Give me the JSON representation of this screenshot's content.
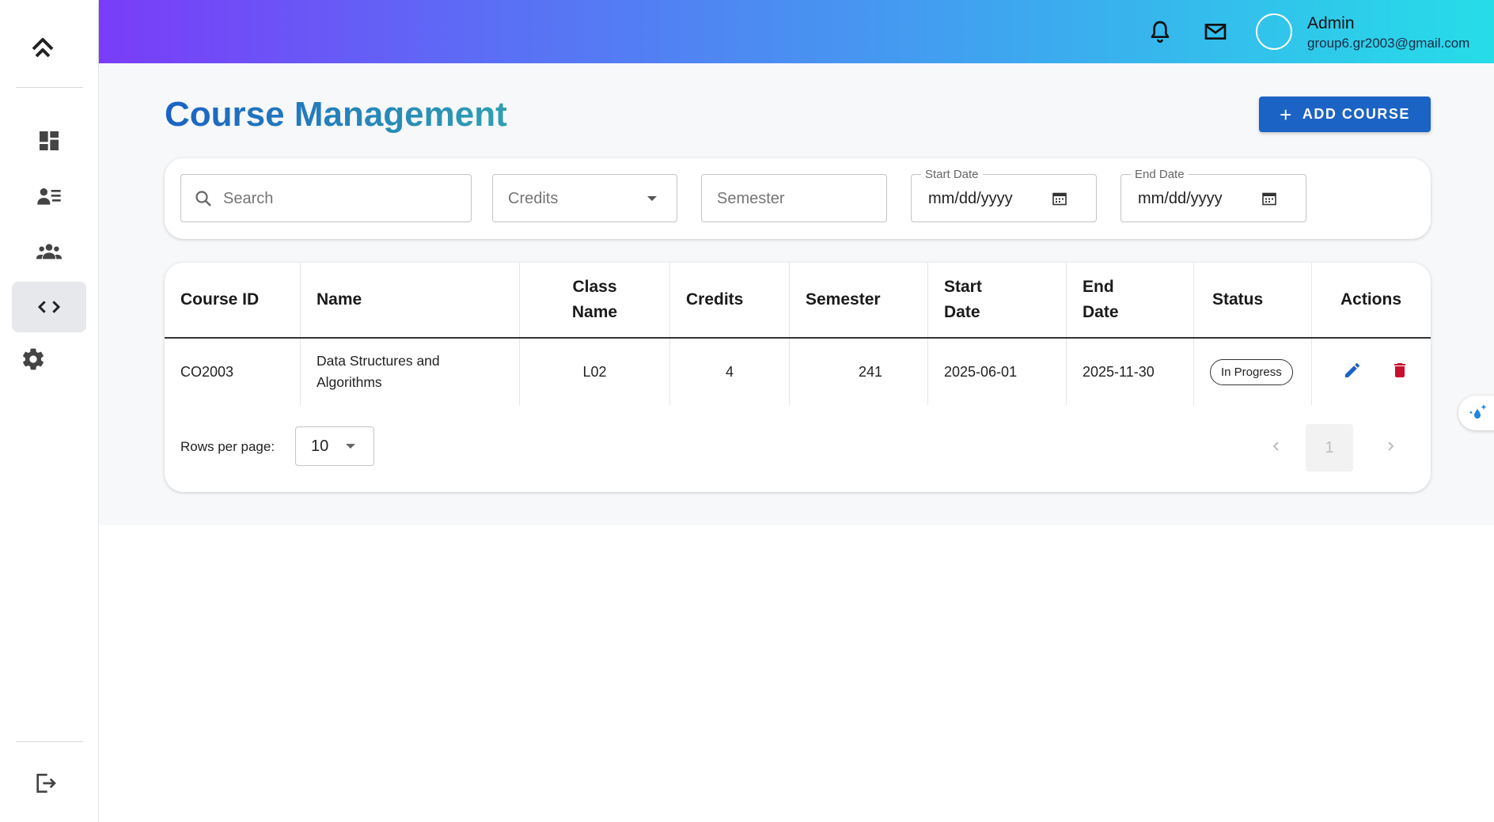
{
  "sidebar": {
    "logo_icon": "double-chevron-up-icon",
    "items": [
      {
        "name": "dashboard",
        "icon": "dashboard-icon",
        "active": false
      },
      {
        "name": "students",
        "icon": "student-list-icon",
        "active": false
      },
      {
        "name": "groups",
        "icon": "groups-icon",
        "active": false
      },
      {
        "name": "courses",
        "icon": "code-icon",
        "active": true
      },
      {
        "name": "settings",
        "icon": "gear-icon",
        "active": false
      }
    ],
    "logout_icon": "logout-icon"
  },
  "header": {
    "gradient": [
      "#7a3cf8",
      "#3ea6ef",
      "#26dde8"
    ],
    "user": {
      "name": "Admin",
      "email": "group6.gr2003@gmail.com"
    }
  },
  "page": {
    "title": "Course Management",
    "add_button_label": "ADD COURSE"
  },
  "filters": {
    "search_placeholder": "Search",
    "credits_placeholder": "Credits",
    "semester_placeholder": "Semester",
    "start_date": {
      "label": "Start Date",
      "value": "mm/dd/yyyy"
    },
    "end_date": {
      "label": "End Date",
      "value": "mm/dd/yyyy"
    }
  },
  "table": {
    "headers": {
      "course_id": "Course ID",
      "name": "Name",
      "class_name": "Class Name",
      "credits": "Credits",
      "semester": "Semester",
      "start_date": "Start Date",
      "end_date": "End Date",
      "status": "Status",
      "actions": "Actions"
    },
    "rows": [
      {
        "course_id": "CO2003",
        "name": "Data Structures and Algorithms",
        "class_name": "L02",
        "credits": "4",
        "semester": "241",
        "start_date": "2025-06-01",
        "end_date": "2025-11-30",
        "status": "In Progress"
      }
    ]
  },
  "pagination": {
    "rows_per_page_label": "Rows per page:",
    "rows_per_page_value": "10",
    "current_page": "1"
  },
  "colors": {
    "primary": "#1b63c4",
    "edit": "#1b63c4",
    "delete": "#c8102e"
  }
}
